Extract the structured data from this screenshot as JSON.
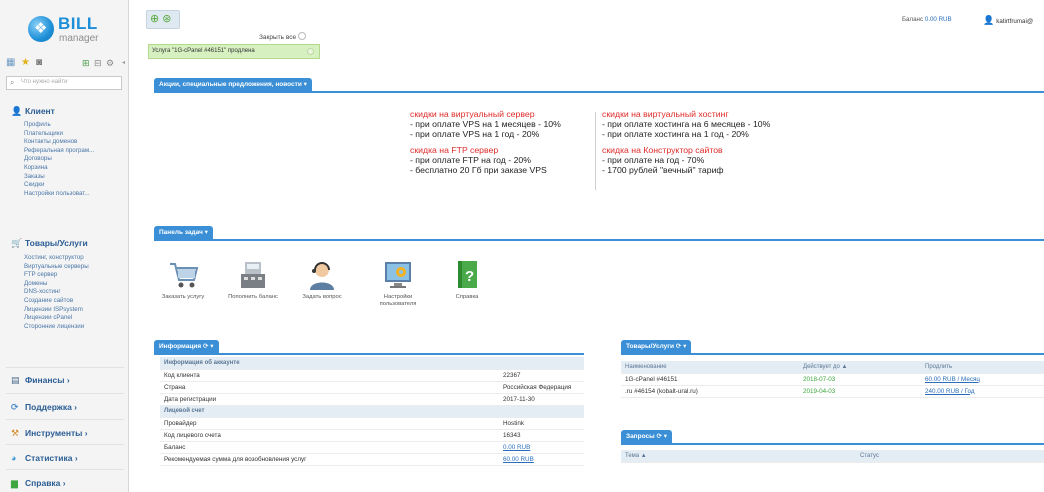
{
  "logo": {
    "name": "BILL",
    "sub": "manager"
  },
  "sidebar": {
    "search_placeholder": "Что нужно найти",
    "groups": [
      {
        "label": "Клиент",
        "items": [
          "Профиль",
          "Плательщики",
          "Контакты доменов",
          "Реферальная програм...",
          "Договоры",
          "Корзина",
          "Заказы",
          "Скидки",
          "Настройки пользоват..."
        ]
      },
      {
        "label": "Товары/Услуги",
        "items": [
          "Хостинг, конструктор",
          "Виртуальные серверы",
          "FTP сервер",
          "Домены",
          "DNS-хостинг",
          "Создание сайтов",
          "Лицензии ISPsystem",
          "Лицензии cPanel",
          "Сторонние лицензии"
        ]
      }
    ],
    "collapsed": [
      "Финансы",
      "Поддержка",
      "Инструменты",
      "Статистика",
      "Справка"
    ]
  },
  "topbar": {
    "close_all": "Закрыть все",
    "notice": "Услуга \"1G-cPanel #46151\" продлена",
    "balance_label": "Баланс",
    "balance_value": "0.00 RUB",
    "user": "katirtfrumai@"
  },
  "promo": {
    "tab": "Акции, специальные предложения, новости",
    "left": [
      {
        "title": "скидки на виртуальный сервер",
        "lines": [
          "- при оплате VPS на 1 месяцев - 10%",
          "- при оплате VPS на 1 год - 20%"
        ]
      },
      {
        "title": "скидка на FTP сервер",
        "lines": [
          "- при оплате FTP на год - 20%",
          "- бесплатно 20 Гб при заказе VPS"
        ]
      }
    ],
    "right": [
      {
        "title": "скидки на виртуальный хостинг",
        "lines": [
          "- при оплате хостинга на 6 месяцев - 10%",
          "- при оплате хостинга на 1 год - 20%"
        ]
      },
      {
        "title": "скидка на Конструктор сайтов",
        "lines": [
          "- при оплате на год - 70%",
          "- 1700 рублей \"вечный\" тариф"
        ]
      }
    ]
  },
  "tasks": {
    "tab": "Панель задач",
    "items": [
      {
        "label": "Заказать услугу",
        "icon": "cart-icon"
      },
      {
        "label": "Пополнить баланс",
        "icon": "cash-register-icon"
      },
      {
        "label": "Задать вопрос",
        "icon": "support-agent-icon"
      },
      {
        "label": "Настройки пользователя",
        "icon": "settings-monitor-icon"
      },
      {
        "label": "Справка",
        "icon": "help-book-icon"
      }
    ]
  },
  "info": {
    "tab": "Информация",
    "section1": "Информация об аккаунте",
    "rows1": [
      {
        "k": "Код клиента",
        "v": "22367"
      },
      {
        "k": "Страна",
        "v": "Российская Федерация"
      },
      {
        "k": "Дата регистрации",
        "v": "2017-11-30"
      }
    ],
    "section2": "Лицевой счет",
    "rows2": [
      {
        "k": "Провайдер",
        "v": "Hostink"
      },
      {
        "k": "Код лицевого счета",
        "v": "16343"
      },
      {
        "k": "Баланс",
        "v": "0.00 RUB"
      },
      {
        "k": "Рекомендуемая сумма для возобновления услуг",
        "v": "60.00 RUB"
      }
    ]
  },
  "services": {
    "tab": "Товары/Услуги",
    "headers": [
      "Наименование",
      "Действует до ▲",
      "Продлить"
    ],
    "rows": [
      {
        "name": "1G-cPanel #46151",
        "until": "2018-07-03",
        "renew": "60.00 RUB / Месяц"
      },
      {
        "name": ".ru #46154 (kobalt-ural.ru)",
        "until": "2019-04-03",
        "renew": "240.00 RUB / Год"
      }
    ]
  },
  "requests": {
    "tab": "Запросы",
    "headers": [
      "Тема ▲",
      "Статус"
    ]
  },
  "colors": {
    "accent": "#3b8fd6",
    "promo_title": "#e02a2a",
    "notice_bg": "#d6f0c0"
  }
}
